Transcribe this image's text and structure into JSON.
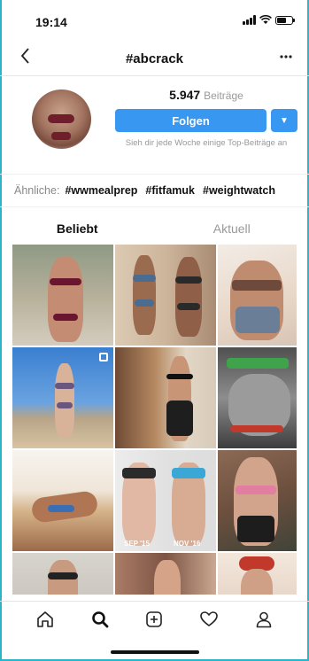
{
  "status_bar": {
    "time": "19:14"
  },
  "nav": {
    "back_icon": "chevron-left-icon",
    "title": "#abcrack",
    "more_icon": "ellipsis-icon"
  },
  "header": {
    "posts_count": "5.947",
    "posts_label": "Beiträge",
    "follow_label": "Folgen",
    "subtitle": "Sieh dir jede Woche einige Top-Beiträge an"
  },
  "related": {
    "label": "Ähnliche:",
    "tags": [
      "#wwmealprep",
      "#fitfamuk",
      "#weightwatch"
    ]
  },
  "tabs": [
    {
      "label": "Beliebt",
      "active": true
    },
    {
      "label": "Aktuell",
      "active": false
    }
  ],
  "grid": {
    "captions": [
      "SEP '15",
      "NOV '16"
    ]
  },
  "bottom_nav": [
    "home-icon",
    "search-icon",
    "add-post-icon",
    "heart-icon",
    "profile-icon"
  ],
  "colors": {
    "accent": "#3897f0",
    "frame": "#29b6c9"
  }
}
